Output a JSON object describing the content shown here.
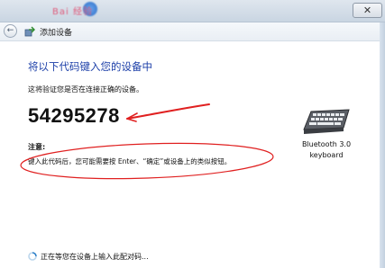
{
  "titlebar": {
    "watermark": "Bai 经验",
    "close_label": "✕"
  },
  "nav": {
    "back_label": "←",
    "title": "添加设备"
  },
  "main": {
    "heading": "将以下代码键入您的设备中",
    "verify_text": "这将验证您是否在连接正确的设备。",
    "code": "54295278",
    "note_label": "注意:",
    "note_text": "键入此代码后，您可能需要按 Enter、“确定”或设备上的类似按钮。"
  },
  "device": {
    "name": "Bluetooth 3.0",
    "type": "keyboard",
    "icon": "keyboard-icon"
  },
  "status": {
    "text": "正在等您在设备上输入此配对码..."
  },
  "colors": {
    "heading": "#1c3fa8",
    "annotation": "#e02020",
    "titlebar": "#c9d5e2"
  }
}
